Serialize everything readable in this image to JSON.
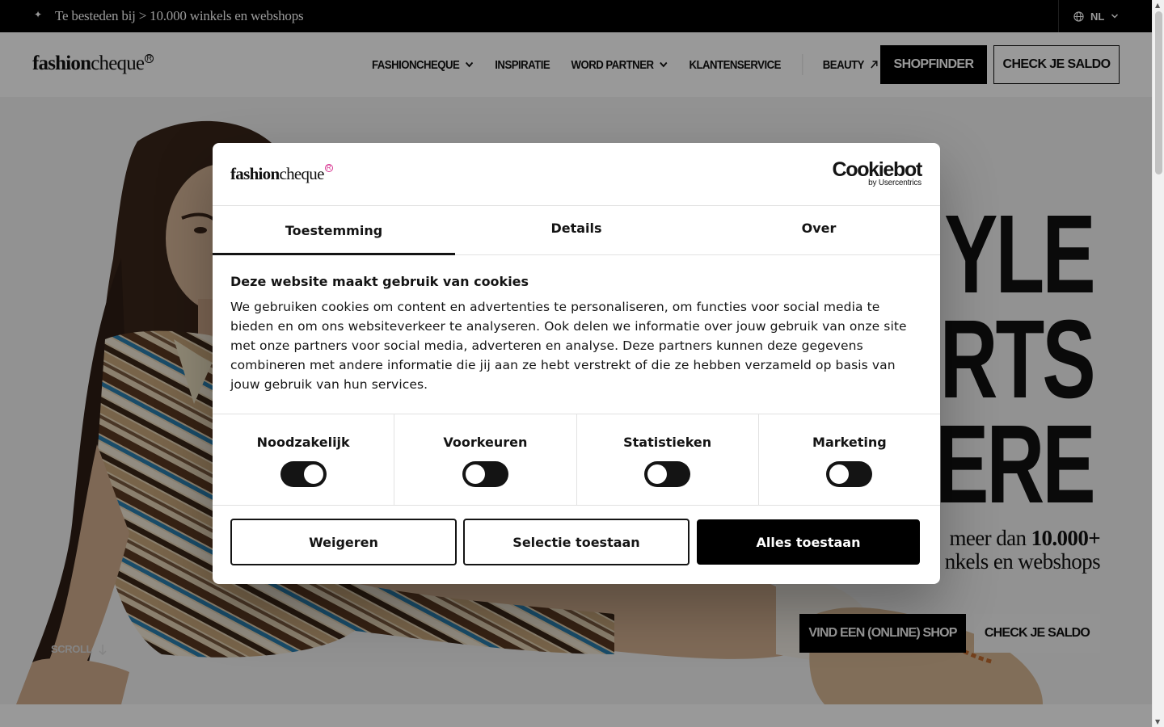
{
  "topbar": {
    "announcement": "Te besteden bij > 10.000 winkels en webshops",
    "language": "NL"
  },
  "header": {
    "logo": {
      "part1": "fashion",
      "part2": "cheque",
      "mark": "R"
    },
    "nav": [
      {
        "label": "FASHIONCHEQUE",
        "dropdown": true
      },
      {
        "label": "INSPIRATIE",
        "dropdown": false
      },
      {
        "label": "WORD PARTNER",
        "dropdown": true
      },
      {
        "label": "KLANTENSERVICE",
        "dropdown": false
      },
      {
        "label": "BEAUTY",
        "external": true
      }
    ],
    "shopfinder_label": "SHOPFINDER",
    "check_saldo_label": "CHECK JE SALDO"
  },
  "hero": {
    "headline": [
      "YLE",
      "RTS",
      "ERE"
    ],
    "sub_line1_prefix": "meer dan ",
    "sub_line1_bold": "10.000+",
    "sub_line2": "nkels en webshops",
    "primary_cta": "VIND EEN (ONLINE) SHOP",
    "secondary_cta": "CHECK JE SALDO",
    "scroll_label": "SCROLL"
  },
  "cookie_dialog": {
    "logo": {
      "part1": "fashion",
      "part2": "cheque",
      "mark": "R"
    },
    "provider": {
      "name": "Cookiebot",
      "by": "by Usercentrics"
    },
    "tabs": [
      "Toestemming",
      "Details",
      "Over"
    ],
    "active_tab": "Toestemming",
    "title": "Deze website maakt gebruik van cookies",
    "text": "We gebruiken cookies om content en advertenties te personaliseren, om functies voor social media te bieden en om ons websiteverkeer te analyseren. Ook delen we informatie over jouw gebruik van onze site met onze partners voor social media, adverteren en analyse. Deze partners kunnen deze gegevens combineren met andere informatie die jij aan ze hebt verstrekt of die ze hebben verzameld op basis van jouw gebruik van hun services.",
    "consents": [
      {
        "label": "Noodzakelijk",
        "enabled": true
      },
      {
        "label": "Voorkeuren",
        "enabled": false
      },
      {
        "label": "Statistieken",
        "enabled": false
      },
      {
        "label": "Marketing",
        "enabled": false
      }
    ],
    "buttons": {
      "deny": "Weigeren",
      "allow_selection": "Selectie toestaan",
      "allow_all": "Alles toestaan"
    }
  },
  "colors": {
    "black": "#000000",
    "text": "#141414",
    "logo_mark_pink": "#d6338f",
    "overlay": "rgba(0,0,0,0.40)"
  }
}
